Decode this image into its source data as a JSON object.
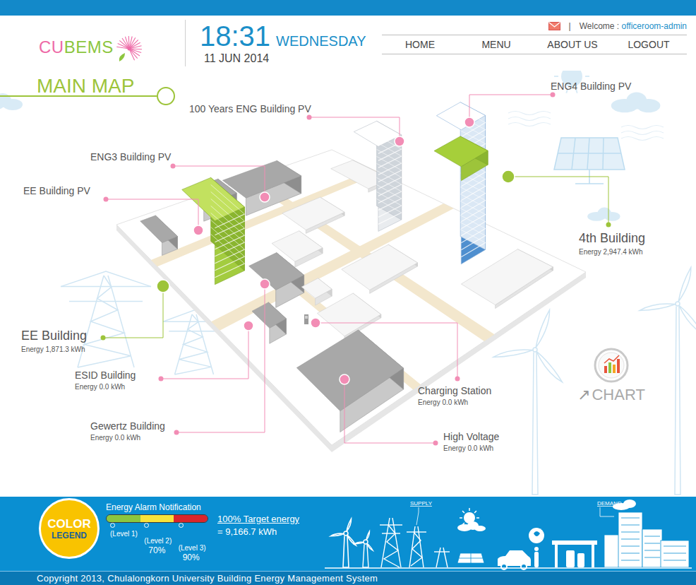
{
  "header": {
    "logo": [
      {
        "text": "CU",
        "color": "#ee6aa7"
      },
      {
        "text": "BEMS",
        "color": "#8dc63f"
      }
    ],
    "time": "18:31",
    "day": "WEDNESDAY",
    "date": "11 JUN 2014",
    "separator": "|",
    "welcome": "Welcome : ",
    "user": "officeroom-admin"
  },
  "nav": [
    "HOME",
    "MENU",
    "ABOUT US",
    "LOGOUT"
  ],
  "map": {
    "title": "MAIN MAP",
    "labels": [
      {
        "name": "100 Years ENG Building PV",
        "kind": "pv"
      },
      {
        "name": "ENG4 Building PV",
        "kind": "pv"
      },
      {
        "name": "ENG3 Building PV",
        "kind": "pv"
      },
      {
        "name": "EE Building PV",
        "kind": "pv"
      },
      {
        "name": "4th Building",
        "kind": "primary",
        "energy": "Energy 2,947.4 kWh"
      },
      {
        "name": "EE Building",
        "kind": "primary",
        "energy": "Energy 1,871.3 kWh"
      },
      {
        "name": "ESID Building",
        "kind": "secondary",
        "energy": "Energy 0.0 kWh"
      },
      {
        "name": "Gewertz Building",
        "kind": "secondary",
        "energy": "Energy 0.0 kWh"
      },
      {
        "name": "Charging Station",
        "kind": "secondary",
        "energy": "Energy 0.0 kWh"
      },
      {
        "name": "High Voltage",
        "kind": "secondary",
        "energy": "Energy 0.0 kWh"
      }
    ],
    "chart_button": {
      "arrow": "↗",
      "label": "CHART"
    }
  },
  "legend": {
    "badge": {
      "top": "COLOR",
      "bottom": "LEGEND"
    },
    "title": "Energy Alarm Notification",
    "levels": [
      {
        "label": "(Level 1)",
        "color": "#8cc63f"
      },
      {
        "label": "(Level 2)",
        "threshold": "70%",
        "color": "#f7e33b"
      },
      {
        "label": "(Level 3)",
        "threshold": "90%",
        "color": "#d9262c"
      }
    ],
    "target_label": "100% Target energy",
    "target_value": "= 9,166.7 kWh"
  },
  "flow": {
    "supply": "SUPPLY",
    "demand": "DEMAND"
  },
  "footer": {
    "copyright": "Copyright 2013, Chulalongkorn University Building Energy Management System"
  }
}
